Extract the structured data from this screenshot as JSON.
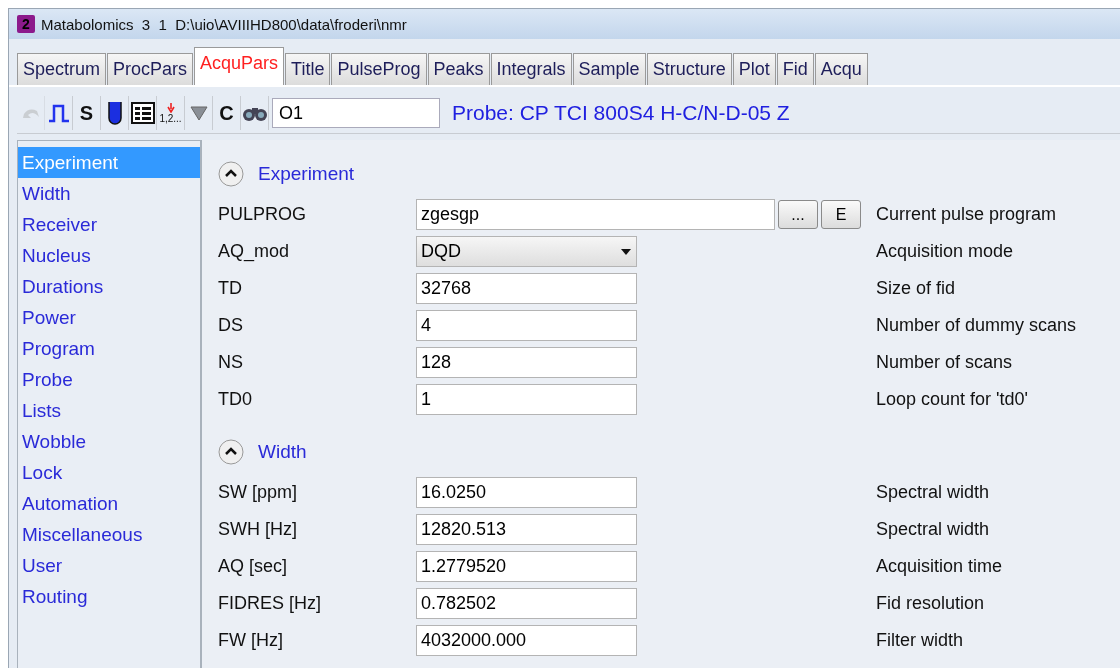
{
  "window": {
    "badge": "2",
    "title": "Matabolomics  3  1  D:\\uio\\AVIIIHD800\\data\\froderi\\nmr"
  },
  "tabs": [
    {
      "label": "Spectrum",
      "selected": false
    },
    {
      "label": "ProcPars",
      "selected": false
    },
    {
      "label": "AcquPars",
      "selected": true
    },
    {
      "label": "Title",
      "selected": false
    },
    {
      "label": "PulseProg",
      "selected": false
    },
    {
      "label": "Peaks",
      "selected": false
    },
    {
      "label": "Integrals",
      "selected": false
    },
    {
      "label": "Sample",
      "selected": false
    },
    {
      "label": "Structure",
      "selected": false
    },
    {
      "label": "Plot",
      "selected": false
    },
    {
      "label": "Fid",
      "selected": false
    },
    {
      "label": "Acqu",
      "selected": false
    }
  ],
  "toolbar": {
    "tools": [
      {
        "kind": "undo",
        "disabled": true
      },
      {
        "kind": "pulse",
        "disabled": false
      },
      {
        "kind": "s",
        "label": "S",
        "disabled": false
      },
      {
        "kind": "tube",
        "disabled": false
      },
      {
        "kind": "grid",
        "disabled": false
      },
      {
        "kind": "order",
        "label": "1,2...",
        "disabled": false
      },
      {
        "kind": "triangle",
        "disabled": false
      },
      {
        "kind": "c",
        "label": "C",
        "disabled": false
      },
      {
        "kind": "binoculars",
        "disabled": false
      }
    ],
    "search_value": "O1",
    "probe": "Probe: CP TCI 800S4 H-C/N-D-05 Z"
  },
  "sidebar": {
    "items": [
      {
        "label": "Experiment",
        "selected": true
      },
      {
        "label": "Width",
        "selected": false
      },
      {
        "label": "Receiver",
        "selected": false
      },
      {
        "label": "Nucleus",
        "selected": false
      },
      {
        "label": "Durations",
        "selected": false
      },
      {
        "label": "Power",
        "selected": false
      },
      {
        "label": "Program",
        "selected": false
      },
      {
        "label": "Probe",
        "selected": false
      },
      {
        "label": "Lists",
        "selected": false
      },
      {
        "label": "Wobble",
        "selected": false
      },
      {
        "label": "Lock",
        "selected": false
      },
      {
        "label": "Automation",
        "selected": false
      },
      {
        "label": "Miscellaneous",
        "selected": false
      },
      {
        "label": "User",
        "selected": false
      },
      {
        "label": "Routing",
        "selected": false
      }
    ]
  },
  "sections": [
    {
      "title": "Experiment",
      "expanded": true,
      "rows": [
        {
          "name": "PULPROG",
          "kind": "program",
          "value": "zgesgp",
          "buttons": [
            "...",
            "E"
          ],
          "description": "Current pulse program"
        },
        {
          "name": "AQ_mod",
          "kind": "select",
          "value": "DQD",
          "description": "Acquisition mode"
        },
        {
          "name": "TD",
          "kind": "text",
          "value": "32768",
          "description": "Size of fid"
        },
        {
          "name": "DS",
          "kind": "text",
          "value": "4",
          "description": "Number of dummy scans"
        },
        {
          "name": "NS",
          "kind": "text",
          "value": "128",
          "description": "Number of scans"
        },
        {
          "name": "TD0",
          "kind": "text",
          "value": "1",
          "description": "Loop count for 'td0'"
        }
      ]
    },
    {
      "title": "Width",
      "expanded": true,
      "rows": [
        {
          "name": "SW [ppm]",
          "kind": "text",
          "value": "16.0250",
          "description": "Spectral width"
        },
        {
          "name": "SWH [Hz]",
          "kind": "text",
          "value": "12820.513",
          "description": "Spectral width"
        },
        {
          "name": "AQ [sec]",
          "kind": "text",
          "value": "1.2779520",
          "description": "Acquisition time"
        },
        {
          "name": "FIDRES [Hz]",
          "kind": "text",
          "value": "0.782502",
          "description": "Fid resolution"
        },
        {
          "name": "FW [Hz]",
          "kind": "text",
          "value": "4032000.000",
          "description": "Filter width"
        }
      ]
    }
  ]
}
